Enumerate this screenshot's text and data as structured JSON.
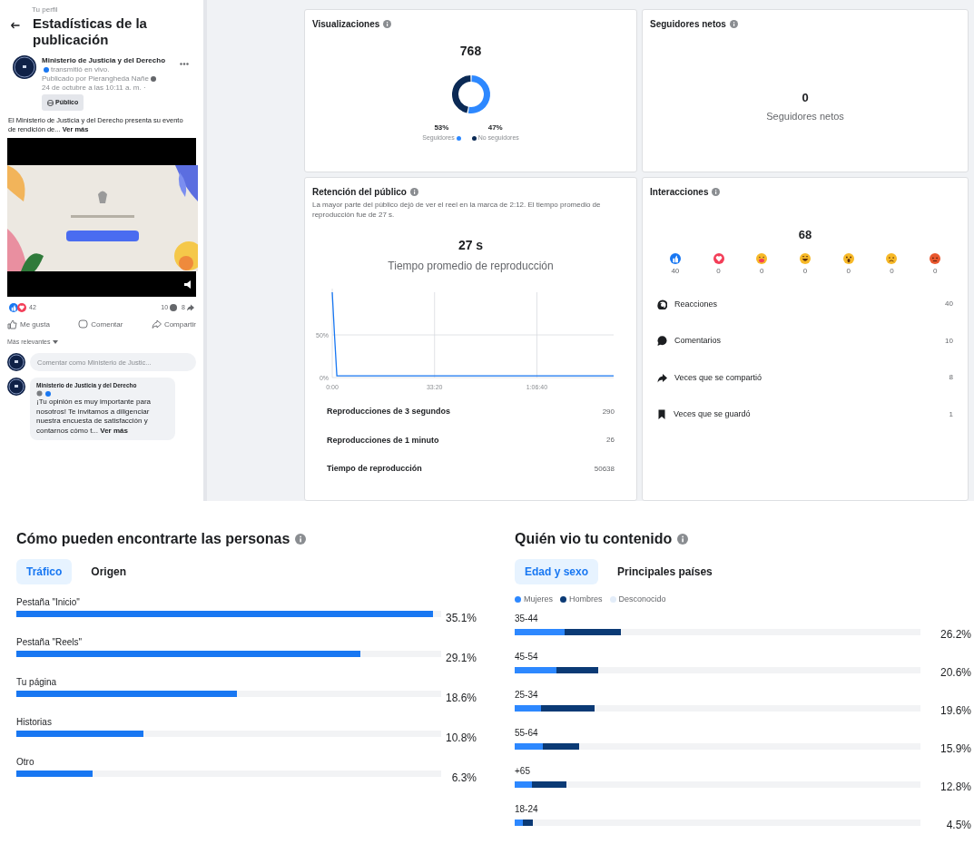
{
  "post_panel": {
    "breadcrumb": "Tu perfil",
    "title": "Estadísticas de la publicación",
    "post": {
      "author": "Ministerio de Justicia y del Derecho",
      "action": "transmitió en vivo.",
      "published_by": "Publicado por Pierangheda Nañe",
      "date": "24 de octubre a las 10:11 a. m. ·",
      "audience": "Público",
      "text": "El Ministerio de Justicia y del Derecho presenta su evento de rendición de...",
      "see_more": "Ver más",
      "media": {
        "kind": "picture"
      },
      "reaction_count": "42",
      "comment_count": "10",
      "share_count": "8",
      "actions": [
        "Me gusta",
        "Comentar",
        "Compartir"
      ],
      "sort": "Más relevantes",
      "comment_field": {
        "placeholder": "Comentar como Ministerio de Justic..."
      },
      "comments": [
        {
          "author": "Ministerio de Justicia y del Derecho",
          "text": "¡Tu opinión es muy importante para nosotros! Te invitamos a diligenciar nuestra encuesta de satisfacción y contarnos cómo t...",
          "see_more": "Ver más"
        }
      ]
    }
  },
  "views": {
    "title": "Visualizaciones",
    "total": "768",
    "chart_data": {
      "type": "donut",
      "categories": [
        "Seguidores",
        "No seguidores"
      ],
      "colors": [
        "#2d88ff",
        "#0b2a55"
      ],
      "values": [
        53,
        47
      ],
      "value_labels": [
        "53%",
        "47%"
      ]
    }
  },
  "net_followers": {
    "title": "Seguidores netos",
    "value": "0",
    "label": "Seguidores netos"
  },
  "retention": {
    "title": "Retención del público",
    "description": "La mayor parte del público dejó de ver el reel en la marca de 2:12. El tiempo promedio de reproducción fue de 27 s.",
    "average": "27 s",
    "average_label": "Tiempo promedio de reproducción",
    "chart_data": {
      "type": "line",
      "grid": true,
      "x": [
        0,
        45,
        90,
        500,
        1000,
        1500,
        2000,
        2500,
        3000,
        3500,
        4000,
        4500,
        5000,
        5500
      ],
      "xlim": [
        0,
        5500
      ],
      "ylim": [
        0,
        100
      ],
      "xticks": [
        {
          "value": 0,
          "label": "0:00"
        },
        {
          "value": 2000,
          "label": "33:20"
        },
        {
          "value": 4000,
          "label": "1:06:40"
        }
      ],
      "yticks": [
        {
          "value": 0,
          "label": "0%"
        },
        {
          "value": 50,
          "label": "50%"
        }
      ],
      "series": [
        {
          "color": "#1877f2",
          "values": [
            100,
            50,
            2,
            2,
            2,
            2,
            2,
            2,
            2,
            2,
            2,
            2,
            2,
            2
          ]
        }
      ]
    },
    "metrics": [
      {
        "label": "Reproducciones de 3 segundos",
        "value": "290"
      },
      {
        "label": "Reproducciones de 1 minuto",
        "value": "26"
      },
      {
        "label": "Tiempo de reproducción",
        "value": "50638"
      }
    ]
  },
  "interactions": {
    "title": "Interacciones",
    "total": "68",
    "reactions": [
      {
        "kind": "like",
        "count": "40"
      },
      {
        "kind": "love",
        "count": "0"
      },
      {
        "kind": "care",
        "count": "0"
      },
      {
        "kind": "haha",
        "count": "0"
      },
      {
        "kind": "wow",
        "count": "0"
      },
      {
        "kind": "sad",
        "count": "0"
      },
      {
        "kind": "angry",
        "count": "0"
      }
    ],
    "breakdown": [
      {
        "kind": "reactions",
        "label": "Reacciones",
        "value": "40"
      },
      {
        "kind": "comments",
        "label": "Comentarios",
        "value": "10"
      },
      {
        "kind": "shares",
        "label": "Veces que se compartió",
        "value": "8"
      },
      {
        "kind": "saves",
        "label": "Veces que se guardó",
        "value": "1"
      }
    ]
  },
  "discovery": {
    "title": "Cómo pueden encontrarte las personas",
    "tabs": [
      {
        "label": "Tráfico",
        "selected": true
      },
      {
        "label": "Origen",
        "selected": false
      }
    ],
    "sources": [
      {
        "label": "Pestaña \"Inicio\"",
        "percentage": "35.1%",
        "level": 0.98
      },
      {
        "label": "Pestaña \"Reels\"",
        "percentage": "29.1%",
        "level": 0.81
      },
      {
        "label": "Tu página",
        "percentage": "18.6%",
        "level": 0.52
      },
      {
        "label": "Historias",
        "percentage": "10.8%",
        "level": 0.3
      },
      {
        "label": "Otro",
        "percentage": "6.3%",
        "level": 0.18
      }
    ]
  },
  "audience": {
    "title": "Quién vio tu contenido",
    "tabs": [
      {
        "label": "Edad y sexo",
        "selected": true
      },
      {
        "label": "Principales países",
        "selected": false
      }
    ],
    "legend": [
      {
        "label": "Mujeres",
        "color": "#2d88ff"
      },
      {
        "label": "Hombres",
        "color": "#0b3a75"
      },
      {
        "label": "Desconocido",
        "color": "#e3edf9"
      }
    ],
    "age_groups": [
      {
        "label": "35-44",
        "percentage": "26.2%",
        "segments": [
          {
            "level": 0.123
          },
          {
            "level": 0.139
          }
        ]
      },
      {
        "label": "45-54",
        "percentage": "20.6%",
        "segments": [
          {
            "level": 0.103
          },
          {
            "level": 0.103
          }
        ]
      },
      {
        "label": "25-34",
        "percentage": "19.6%",
        "segments": [
          {
            "level": 0.065
          },
          {
            "level": 0.131
          }
        ]
      },
      {
        "label": "55-64",
        "percentage": "15.9%",
        "segments": [
          {
            "level": 0.07
          },
          {
            "level": 0.089
          }
        ]
      },
      {
        "label": "+65",
        "percentage": "12.8%",
        "segments": [
          {
            "level": 0.042
          },
          {
            "level": 0.086
          }
        ]
      },
      {
        "label": "18-24",
        "percentage": "4.5%",
        "segments": [
          {
            "level": 0.02
          },
          {
            "level": 0.025
          }
        ]
      }
    ]
  }
}
